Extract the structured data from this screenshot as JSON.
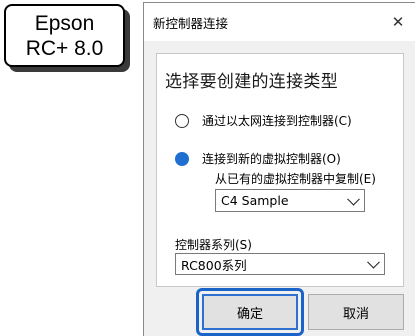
{
  "callout": {
    "line1": "Epson",
    "line2": "RC+ 8.0"
  },
  "dialog": {
    "title": "新控制器连接",
    "close_icon": "✕",
    "heading": "选择要创建的连接类型",
    "options": [
      {
        "label": "通过以太网连接到控制器(C)",
        "checked": false
      },
      {
        "label": "连接到新的虚拟控制器(O)",
        "checked": true
      }
    ],
    "copy_label": "从已有的虚拟控制器中复制(E)",
    "copy_select": "C4 Sample",
    "series_label": "控制器系列(S)",
    "series_select": "RC800系列",
    "ok_label": "确定",
    "cancel_label": "取消"
  }
}
